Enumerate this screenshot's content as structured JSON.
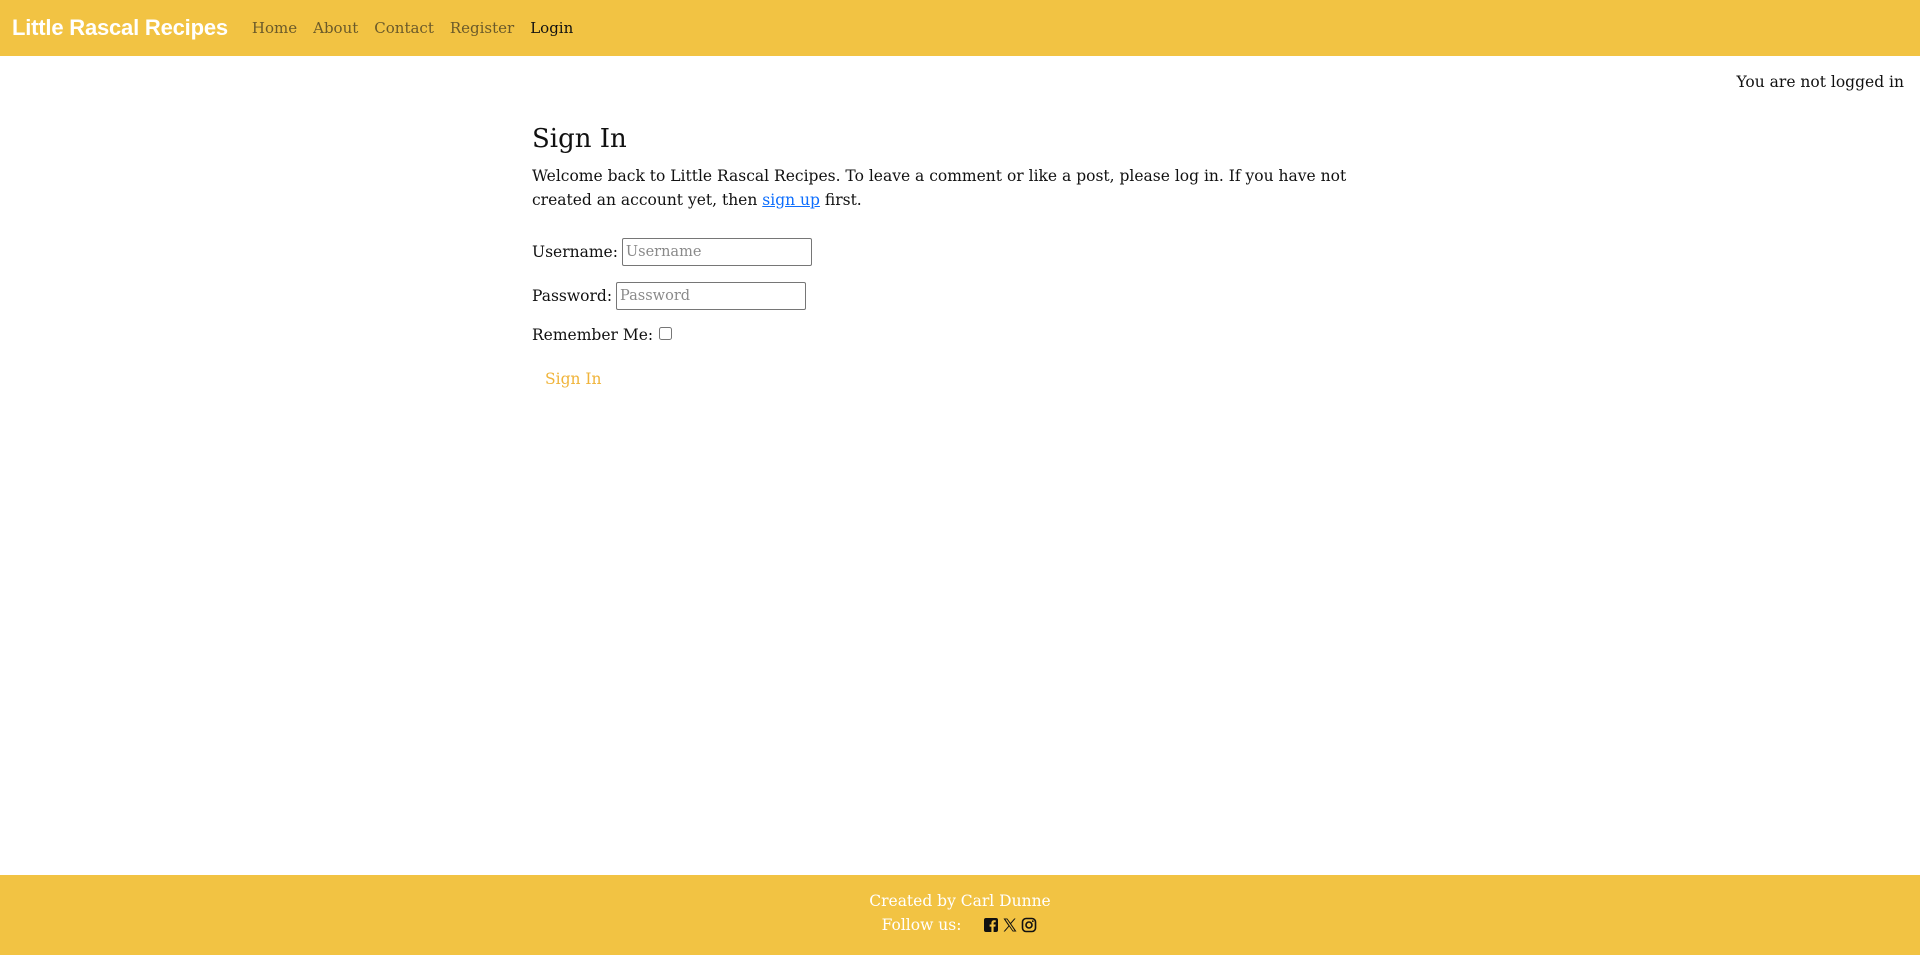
{
  "navbar": {
    "brand": "Little Rascal Recipes",
    "links": [
      {
        "label": "Home"
      },
      {
        "label": "About"
      },
      {
        "label": "Contact"
      },
      {
        "label": "Register"
      },
      {
        "label": "Login",
        "active": true
      }
    ],
    "background_color": "#f2c343"
  },
  "status": {
    "text": "You are not logged in"
  },
  "main": {
    "title": "Sign In",
    "intro_before": "Welcome back to Little Rascal Recipes. To leave a comment or like a post, please log in. If you have not created an account yet, then ",
    "intro_link": "sign up",
    "intro_after": " first."
  },
  "form": {
    "username_label": "Username:",
    "username_placeholder": "Username",
    "username_value": "",
    "password_label": "Password:",
    "password_placeholder": "Password",
    "password_value": "",
    "remember_label": "Remember Me:",
    "remember_checked": false,
    "submit_label": "Sign In",
    "submit_color": "#f0b43a"
  },
  "footer": {
    "created_by": "Created by Carl Dunne",
    "follow_label": "Follow us:",
    "social_icons": [
      "facebook-icon",
      "x-twitter-icon",
      "instagram-icon"
    ]
  }
}
